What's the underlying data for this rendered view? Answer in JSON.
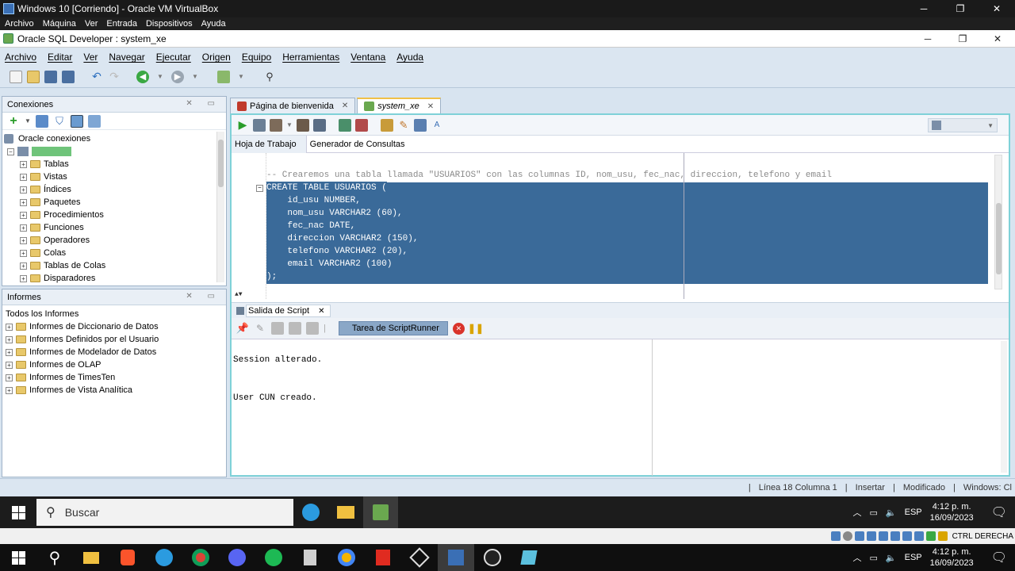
{
  "vbox": {
    "title": "Windows 10 [Corriendo] - Oracle VM VirtualBox",
    "menu": [
      "Archivo",
      "Máquina",
      "Ver",
      "Entrada",
      "Dispositivos",
      "Ayuda"
    ]
  },
  "app": {
    "title": "Oracle SQL Developer : system_xe",
    "menu": [
      "Archivo",
      "Editar",
      "Ver",
      "Navegar",
      "Ejecutar",
      "Origen",
      "Equipo",
      "Herramientas",
      "Ventana",
      "Ayuda"
    ]
  },
  "connections": {
    "header": "Conexiones",
    "root": "Oracle conexiones",
    "items": [
      "Tablas",
      "Vistas",
      "Índices",
      "Paquetes",
      "Procedimientos",
      "Funciones",
      "Operadores",
      "Colas",
      "Tablas de Colas",
      "Disparadores"
    ]
  },
  "reports": {
    "header": "Informes",
    "root": "Todos los Informes",
    "items": [
      "Informes de Diccionario de Datos",
      "Informes Definidos por el Usuario",
      "Informes de Modelador de Datos",
      "Informes de OLAP",
      "Informes de TimesTen",
      "Informes de Vista Analítica"
    ]
  },
  "editor": {
    "tabs": [
      "Página de bienvenida",
      "system_xe"
    ],
    "subtabs": [
      "Hoja de Trabajo",
      "Generador de Consultas"
    ],
    "code": [
      "-- Crearemos una tabla llamada \"USUARIOS\" con las columnas ID, nom_usu, fec_nac, direccion, telefono y email",
      "CREATE TABLE USUARIOS (",
      "    id_usu NUMBER,",
      "    nom_usu VARCHAR2 (60),",
      "    fec_nac DATE,",
      "    direccion VARCHAR2 (150),",
      "    telefono VARCHAR2 (20),",
      "    email VARCHAR2 (100)",
      ");"
    ]
  },
  "output": {
    "tab": "Salida de Script",
    "runner": "Tarea de ScriptRunner",
    "lines": [
      "Session alterado.",
      "User CUN creado."
    ]
  },
  "status": {
    "position": "Línea 18 Columna 1",
    "mode": "Insertar",
    "modified": "Modificado",
    "os": "Windows: Cl"
  },
  "taskbar": {
    "search": "Buscar",
    "lang": "ESP",
    "time": "4:12 p. m.",
    "date": "16/09/2023",
    "host_key": "CTRL DERECHA"
  }
}
